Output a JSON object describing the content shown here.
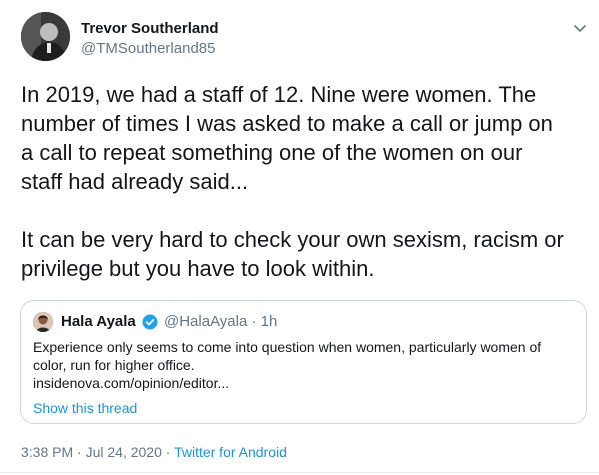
{
  "author": {
    "name": "Trevor Southerland",
    "handle": "@TMSoutherland85"
  },
  "tweet": {
    "paragraph_1": "In 2019, we had a staff of 12. Nine were women. The\nnumber of times I was asked to make a call or jump on\na call to repeat something one of the women on our\nstaff had already said...",
    "paragraph_2": "It can be very hard to check your own sexism, racism or\nprivilege but you have to look within."
  },
  "quoted_tweet": {
    "name": "Hala Ayala",
    "handle_time": "@HalaAyala · 1h",
    "text_line_1": "Experience only seems to come into question when women, particularly women of",
    "text_line_2": "color, run for higher office.",
    "link": "insidenova.com/opinion/editor...",
    "show_thread": "Show this thread",
    "verified": true
  },
  "meta": {
    "timestamp": "3:38 PM · Jul 24, 2020 · ",
    "source": "Twitter for Android"
  },
  "colors": {
    "link": "#1b95e0",
    "secondary_text": "#657786",
    "border": "#ccd6dd",
    "verified": "#1da1f2"
  },
  "icons": {
    "menu": "chevron-down-icon",
    "verified": "verified-badge-icon"
  }
}
